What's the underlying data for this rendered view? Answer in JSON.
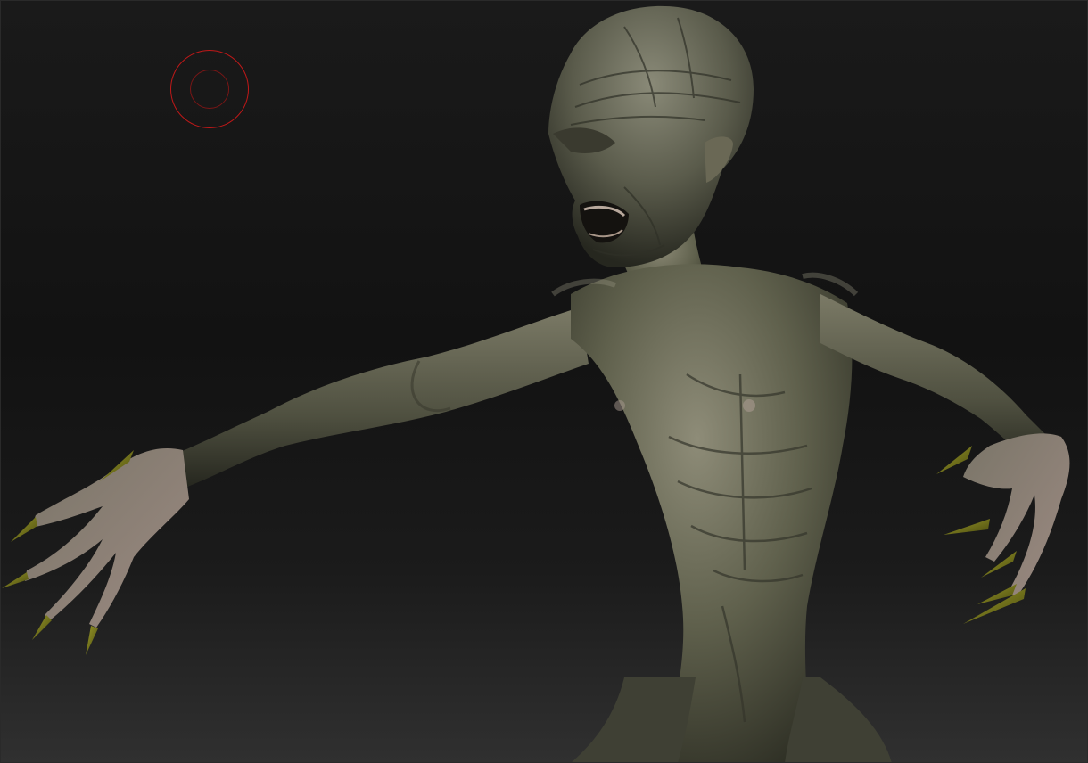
{
  "viewport": {
    "background": "dark-gradient",
    "model": "creature-sculpt"
  },
  "brush_cursor": {
    "icon": "brush-draw-size-icon",
    "outer_color": "#c01818",
    "inner_color": "#7a1616"
  },
  "palette": {
    "skin_light": "#8e8c78",
    "skin_mid": "#5d5e4b",
    "skin_dark": "#2e2f25",
    "claw": "#7a7a18",
    "flesh_pink": "#a48c84"
  }
}
